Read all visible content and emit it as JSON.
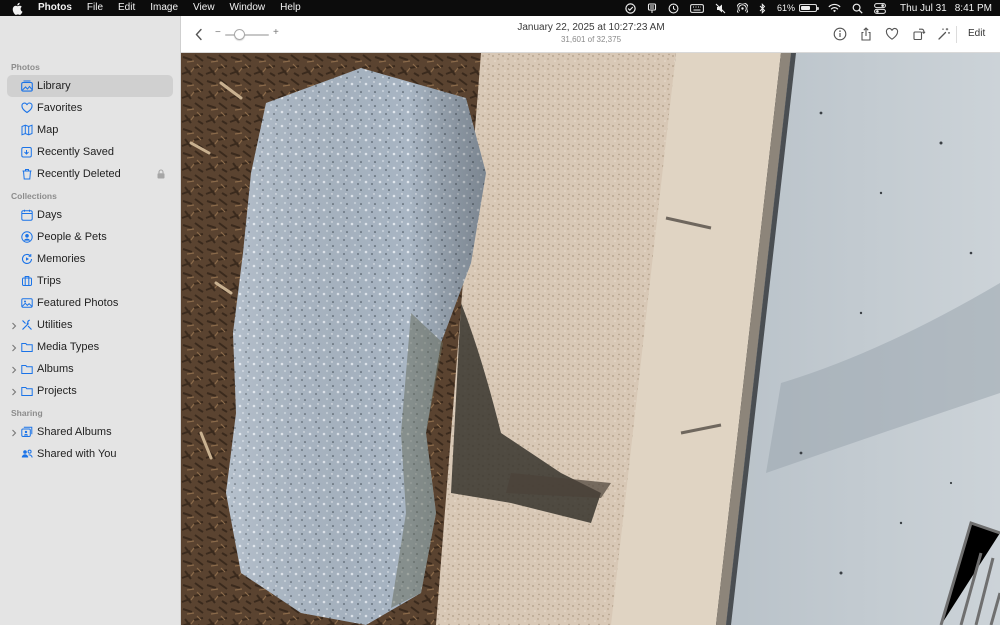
{
  "menubar": {
    "app_name": "Photos",
    "menus": [
      "File",
      "Edit",
      "Image",
      "View",
      "Window",
      "Help"
    ],
    "battery_percent": "61%",
    "battery_level": 0.61,
    "date": "Thu Jul 31",
    "time": "8:41 PM"
  },
  "sidebar": {
    "sections": [
      {
        "title": "Photos",
        "items": [
          {
            "label": "Library",
            "icon": "library-icon",
            "active": true
          },
          {
            "label": "Favorites",
            "icon": "heart-icon"
          },
          {
            "label": "Map",
            "icon": "map-icon"
          },
          {
            "label": "Recently Saved",
            "icon": "recently-saved-icon"
          },
          {
            "label": "Recently Deleted",
            "icon": "trash-icon",
            "locked": true
          }
        ]
      },
      {
        "title": "Collections",
        "items": [
          {
            "label": "Days",
            "icon": "calendar-icon"
          },
          {
            "label": "People & Pets",
            "icon": "person-icon"
          },
          {
            "label": "Memories",
            "icon": "memories-icon"
          },
          {
            "label": "Trips",
            "icon": "suitcase-icon"
          },
          {
            "label": "Featured Photos",
            "icon": "photo-icon"
          },
          {
            "label": "Utilities",
            "icon": "tools-icon",
            "expandable": true
          },
          {
            "label": "Media Types",
            "icon": "folder-icon",
            "expandable": true
          },
          {
            "label": "Albums",
            "icon": "folder-icon",
            "expandable": true
          },
          {
            "label": "Projects",
            "icon": "folder-icon",
            "expandable": true
          }
        ]
      },
      {
        "title": "Sharing",
        "items": [
          {
            "label": "Shared Albums",
            "icon": "shared-albums-icon",
            "expandable": true
          },
          {
            "label": "Shared with You",
            "icon": "shared-with-you-icon"
          }
        ]
      }
    ]
  },
  "toolbar": {
    "zoom_minus": "−",
    "zoom_plus": "+",
    "title": "January 22, 2025 at 10:27:23 AM",
    "subtitle": "31,601 of 32,375",
    "edit_label": "Edit"
  },
  "colors": {
    "accent": "#1a73e8",
    "sidebar_bg": "#e4e4e4",
    "selection": "#d0d0d0"
  }
}
